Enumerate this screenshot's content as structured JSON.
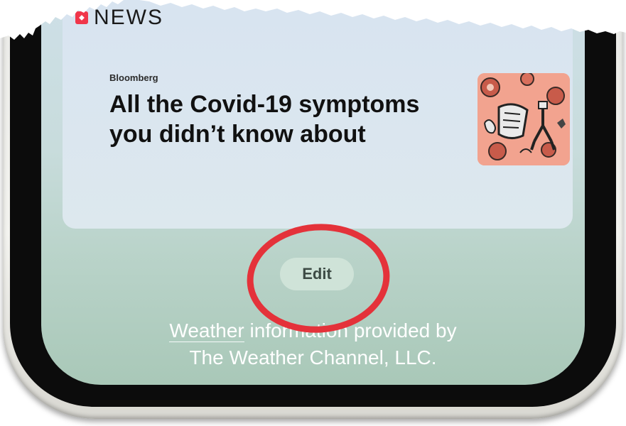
{
  "widget": {
    "header_label": "NEWS",
    "source": "Bloomberg",
    "headline_line1": "All the Covid-19 symptoms",
    "headline_line2": "you didn’t know about"
  },
  "edit_button": {
    "label": "Edit"
  },
  "footer": {
    "link_text": "Weather",
    "line1_rest": " information provided by",
    "line2": "The Weather Channel, LLC."
  },
  "colors": {
    "annotation_red": "#e4323a",
    "news_logo": "#f0364a",
    "edit_button_bg": "#cfe3d8"
  },
  "icons": {
    "news_logo": "apple-news-icon",
    "thumbnail": "covid-illustration-thumbnail"
  }
}
